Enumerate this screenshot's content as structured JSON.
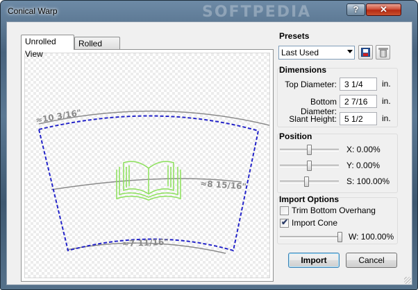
{
  "window": {
    "title": "Conical Warp",
    "watermark": "SOFTPEDIA",
    "help_glyph": "?",
    "close_glyph": "✕"
  },
  "tabs": [
    {
      "label": "Unrolled View",
      "active": true
    },
    {
      "label": "Rolled View",
      "active": false
    }
  ],
  "preview": {
    "top_arc_label": "≈10 3/16\"",
    "middle_arc_label": "≈8 15/16\"",
    "bottom_arc_label": "≈7 11/16\"",
    "colors": {
      "outline": "#2323c8",
      "guide": "#8a8a8a",
      "artwork": "#8be05a"
    },
    "artwork_icon": "open-book-icon"
  },
  "presets": {
    "title": "Presets",
    "selected": "Last Used",
    "save_icon": "save-preset-icon",
    "delete_icon": "delete-preset-icon"
  },
  "dimensions": {
    "title": "Dimensions",
    "top_diameter": {
      "label": "Top Diameter:",
      "value": "3 1/4",
      "unit": "in."
    },
    "bottom_diameter": {
      "label": "Bottom Diameter:",
      "value": "2 7/16",
      "unit": "in."
    },
    "slant_height": {
      "label": "Slant Height:",
      "value": "5 1/2",
      "unit": "in."
    }
  },
  "position": {
    "title": "Position",
    "x": {
      "label": "X: 0.00%",
      "level": 0.5
    },
    "y": {
      "label": "Y: 0.00%",
      "level": 0.5
    },
    "s": {
      "label": "S: 100.00%",
      "level": 0.45
    }
  },
  "import_options": {
    "title": "Import Options",
    "trim_bottom_overhang": {
      "label": "Trim Bottom Overhang",
      "checked": false
    },
    "import_cone": {
      "label": "Import Cone",
      "checked": true
    },
    "w": {
      "label": "W: 100.00%",
      "level": 1.0
    }
  },
  "buttons": {
    "import": "Import",
    "cancel": "Cancel"
  }
}
